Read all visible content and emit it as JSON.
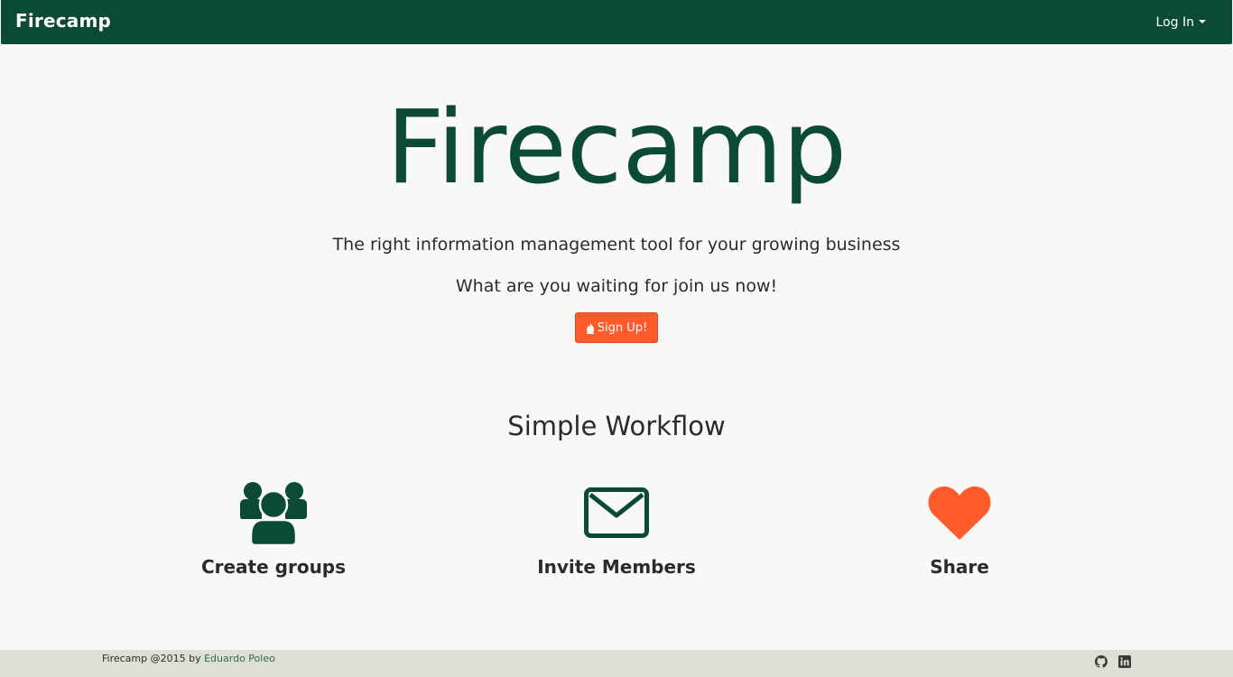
{
  "navbar": {
    "brand": "Firecamp",
    "login_label": "Log In"
  },
  "hero": {
    "title": "Firecamp",
    "tagline": "The right information management tool for your growing business",
    "subtagline": "What are you waiting for join us now!",
    "signup_label": "Sign Up!",
    "signup_icon": "fire-icon"
  },
  "workflow": {
    "title": "Simple Workflow",
    "features": [
      {
        "label": "Create groups",
        "icon": "users-icon"
      },
      {
        "label": "Invite Members",
        "icon": "envelope-icon"
      },
      {
        "label": "Share",
        "icon": "heart-icon"
      }
    ]
  },
  "footer": {
    "text": "Firecamp @2015 by",
    "author": "Eduardo Poleo",
    "icons": [
      "github-icon",
      "linkedin-icon"
    ]
  },
  "colors": {
    "primary": "#0b4a33",
    "accent": "#ff5a2c",
    "footer_bg": "#dfdfd6"
  }
}
